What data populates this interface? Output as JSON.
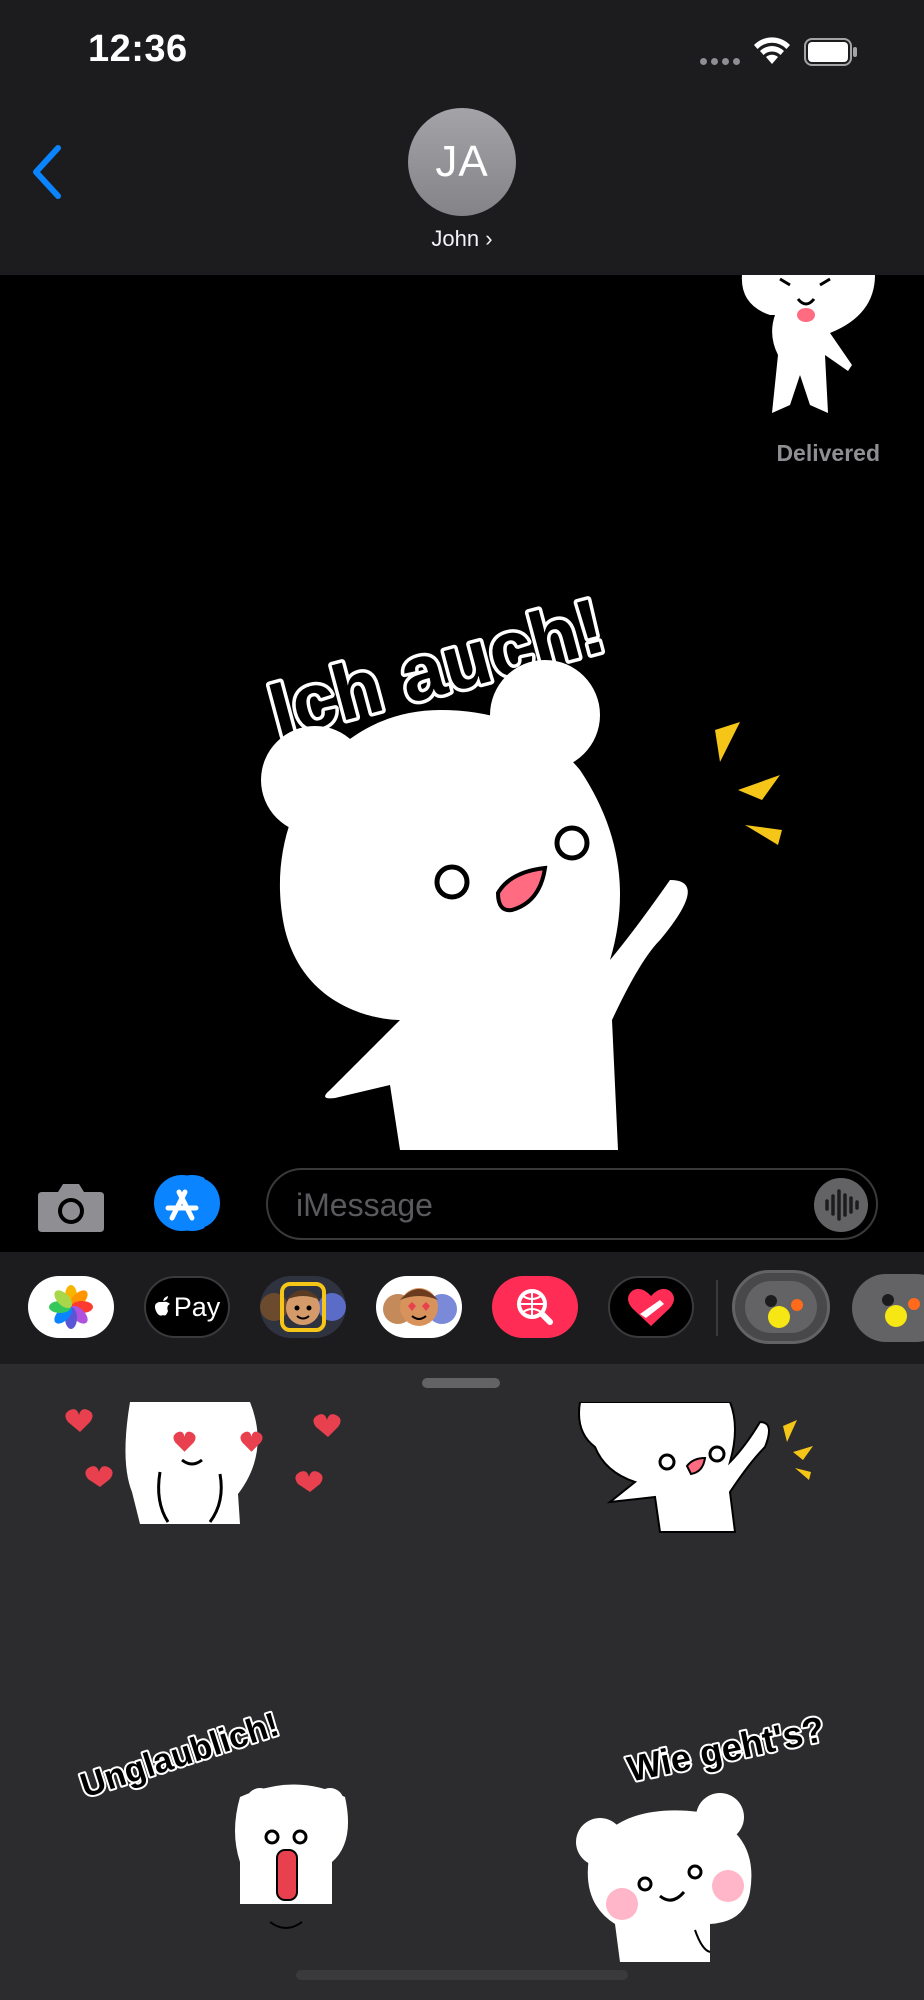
{
  "status": {
    "time": "12:36"
  },
  "header": {
    "avatar_initials": "JA",
    "contact_name": "John ›"
  },
  "chat": {
    "delivered_label": "Delivered",
    "main_sticker_text": "Ich auch!"
  },
  "input": {
    "placeholder": "iMessage"
  },
  "app_drawer": {
    "apple_pay_label": "Pay",
    "apps": [
      "photos-app",
      "apple-pay-app",
      "memoji-app",
      "memoji-stickers-app",
      "image-search-app",
      "digital-touch-app",
      "sticker-app-selected",
      "sticker-app"
    ]
  },
  "stickers": {
    "items": [
      {
        "text": ""
      },
      {
        "text": ""
      },
      {
        "text": "Unglaublich!"
      },
      {
        "text": "Wie geht's?"
      }
    ]
  },
  "colors": {
    "accent": "#0a84ff",
    "yellow": "#f5c518",
    "pink": "#ff6b81",
    "heart": "#e8404e"
  }
}
